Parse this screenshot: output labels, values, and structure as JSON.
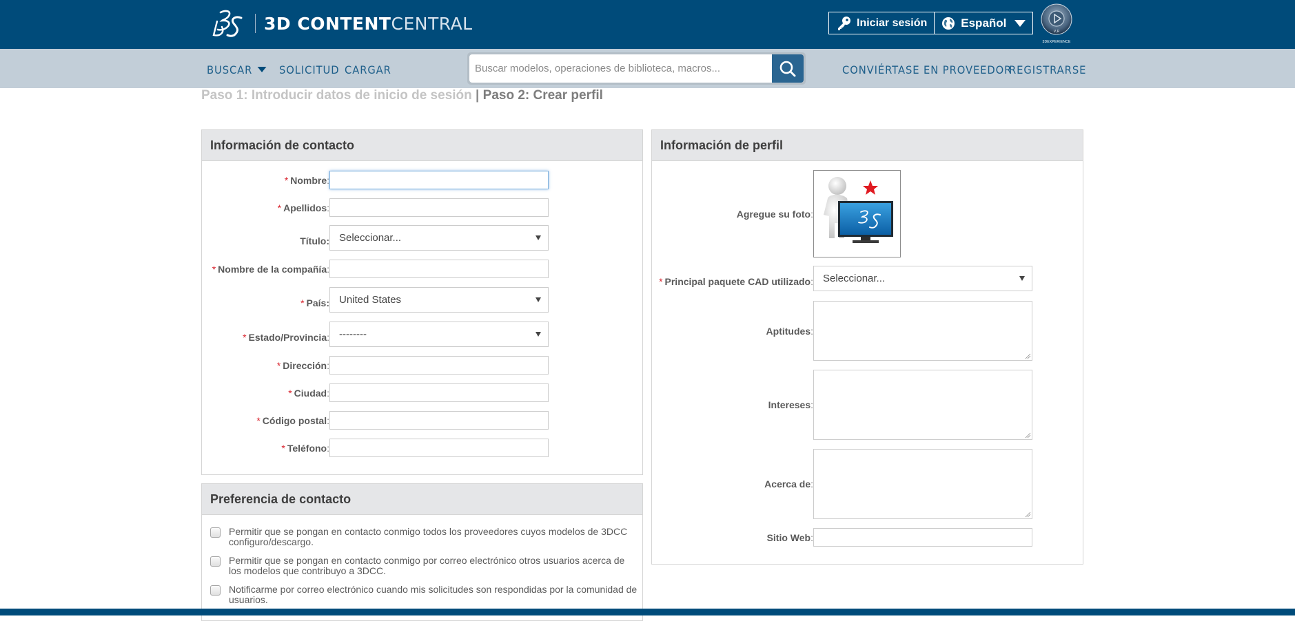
{
  "header": {
    "brand_bold": "3D CONTENT",
    "brand_light": "CENTRAL",
    "login_label": "Iniciar sesión",
    "language_label": "Español",
    "experience_caption": "3DEXPERIENCE",
    "icons": {
      "logo": "ds-logo-icon",
      "login": "key-icon",
      "language": "globe-icon",
      "language_caret": "caret-down-icon",
      "experience": "3dexperience-compass-icon"
    }
  },
  "nav": {
    "left": [
      {
        "label": "BUSCAR",
        "has_caret": true
      },
      {
        "label": "SOLICITUD"
      },
      {
        "label": "CARGAR"
      }
    ],
    "search": {
      "placeholder": "Buscar modelos, operaciones de biblioteca, macros...",
      "value": "",
      "icon": "search-icon"
    },
    "right": [
      {
        "label": "CONVIÉRTASE EN PROVEEDOR"
      },
      {
        "label": "REGISTRARSE"
      }
    ]
  },
  "steps": {
    "step1": "Paso 1: Introducir datos de inicio de sesión",
    "separator": "|",
    "step2": "Paso 2: Crear perfil"
  },
  "contact_info": {
    "title": "Información de contacto",
    "fields": [
      {
        "label": "Nombre",
        "required": true,
        "type": "text",
        "value": "",
        "focused": true
      },
      {
        "label": "Apellidos",
        "required": true,
        "type": "text",
        "value": ""
      },
      {
        "label": "Título",
        "required": false,
        "type": "select",
        "value": "Seleccionar..."
      },
      {
        "label": "Nombre de la compañía",
        "required": true,
        "type": "text",
        "value": ""
      },
      {
        "label": "País",
        "required": true,
        "type": "select",
        "value": "United States"
      },
      {
        "label": "Estado/Provincia",
        "required": true,
        "type": "select",
        "value": "--------"
      },
      {
        "label": "Dirección",
        "required": true,
        "type": "text",
        "value": ""
      },
      {
        "label": "Ciudad",
        "required": true,
        "type": "text",
        "value": ""
      },
      {
        "label": "Código postal",
        "required": true,
        "type": "text",
        "value": ""
      },
      {
        "label": "Teléfono",
        "required": true,
        "type": "text",
        "value": ""
      }
    ]
  },
  "contact_pref": {
    "title": "Preferencia de contacto",
    "options": [
      {
        "label": "Permitir que se pongan en contacto conmigo todos los proveedores cuyos modelos de 3DCC configuro/descargo.",
        "checked": false
      },
      {
        "label": "Permitir que se pongan en contacto conmigo por correo electrónico otros usuarios acerca de los modelos que contribuyo a 3DCC.",
        "checked": false
      },
      {
        "label": "Notificarme por correo electrónico cuando mis solicitudes son respondidas por la comunidad de usuarios.",
        "checked": false
      }
    ]
  },
  "profile_info": {
    "title": "Información de perfil",
    "photo_label": "Agregue su foto",
    "photo_icon": "default-avatar-icon",
    "cad_label": "Principal paquete CAD utilizado",
    "cad_required": true,
    "cad_value": "Seleccionar...",
    "skills_label": "Aptitudes",
    "skills_value": "",
    "interests_label": "Intereses",
    "interests_value": "",
    "about_label": "Acerca de",
    "about_value": "",
    "website_label": "Sitio Web",
    "website_value": ""
  },
  "required_marker": "*",
  "label_suffix": ":",
  "colors": {
    "brand_blue": "#004b7a",
    "nav_bg": "#c2ced8",
    "nav_text": "#1e5f8a",
    "search_btn": "#2a6591",
    "required_red": "#d9232d",
    "panel_header_bg": "#e5e6e8"
  }
}
